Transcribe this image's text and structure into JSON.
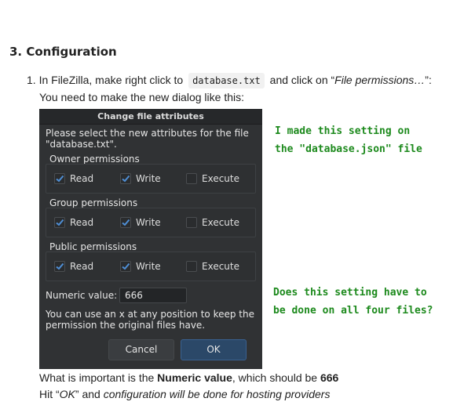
{
  "section": {
    "heading": "3. Configuration"
  },
  "step": {
    "number": "1.",
    "text_before": "In FileZilla, make right click to",
    "code": "database.txt",
    "text_middle": "and click on “",
    "italic": "File permissions…",
    "text_after": "”:"
  },
  "instruction": "You need to make the new dialog like this:",
  "dialog": {
    "title": "Change file attributes",
    "description_line1": "Please select the new attributes for the file",
    "description_line2": "\"database.txt\".",
    "groups": [
      {
        "label": "Owner permissions",
        "read": "Read",
        "write": "Write",
        "execute": "Execute",
        "read_checked": true,
        "write_checked": true,
        "execute_checked": false
      },
      {
        "label": "Group permissions",
        "read": "Read",
        "write": "Write",
        "execute": "Execute",
        "read_checked": true,
        "write_checked": true,
        "execute_checked": false
      },
      {
        "label": "Public permissions",
        "read": "Read",
        "write": "Write",
        "execute": "Execute",
        "read_checked": true,
        "write_checked": true,
        "execute_checked": false
      }
    ],
    "numeric_label": "Numeric value:",
    "numeric_value": "666",
    "hint_line1": "You can use an x at any position to keep the",
    "hint_line2": "permission the original files have.",
    "cancel_label": "Cancel",
    "ok_label": "OK"
  },
  "annotations": {
    "note1_line1": "I made this setting on",
    "note1_line2": "the \"database.json\" file",
    "note2_line1": "Does this setting have to",
    "note2_line2": "be done on all four files?",
    "color": "#1d8a1d"
  },
  "footer": {
    "line1_prefix": "What is important is the ",
    "line1_bold": "Numeric value",
    "line1_middle": ", which should be ",
    "line1_value": "666",
    "line2_prefix": "Hit “",
    "line2_italic_ok": "OK",
    "line2_middle": "” and ",
    "line2_italic_rest": "configuration will be done for hosting providers"
  }
}
